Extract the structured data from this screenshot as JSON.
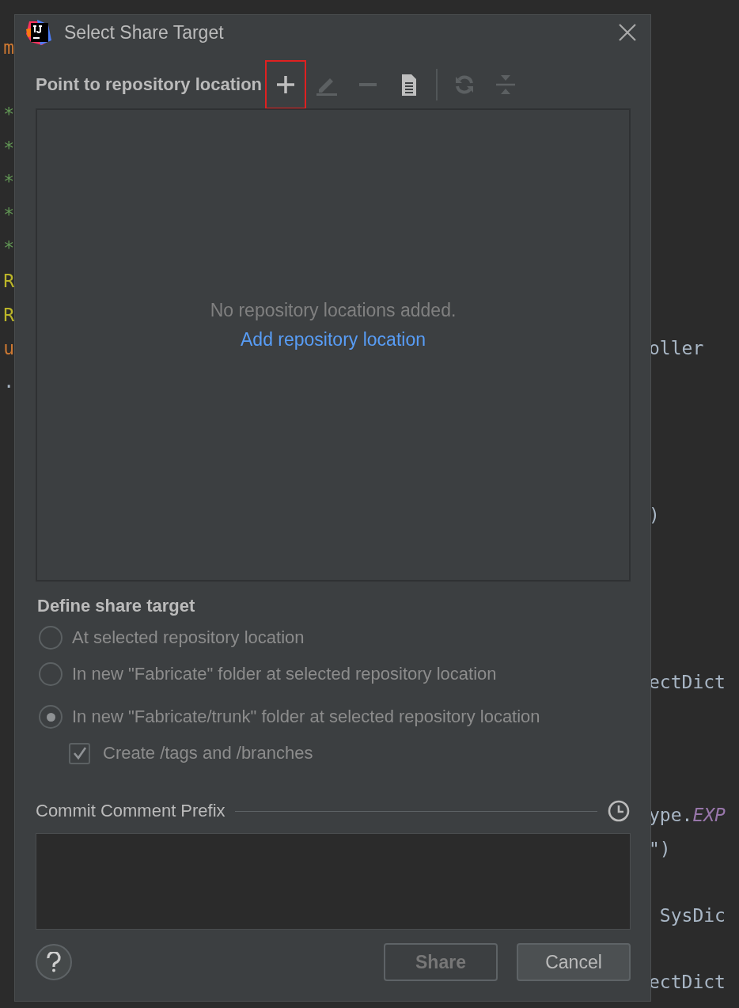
{
  "editor": {
    "left_fragments": [
      {
        "text": "m",
        "kind": "keyword"
      },
      {
        "text": "*",
        "kind": "comment"
      },
      {
        "text": "*",
        "kind": "comment"
      },
      {
        "text": "*",
        "kind": "comment"
      },
      {
        "text": "*",
        "kind": "comment"
      },
      {
        "text": "*",
        "kind": "comment"
      },
      {
        "text": "R",
        "kind": "annotation"
      },
      {
        "text": "R",
        "kind": "annotation"
      },
      {
        "text": "u",
        "kind": "keyword"
      },
      {
        "text": ".",
        "kind": "plain"
      }
    ],
    "right_fragments": [
      {
        "text": "oller",
        "kind": "plain"
      },
      {
        "text": ")",
        "kind": "plain"
      },
      {
        "text": "ectDict",
        "kind": "plain"
      },
      {
        "text": "ype.",
        "kind": "plain"
      },
      {
        "text": "EXP",
        "kind": "constant"
      },
      {
        "text": "\")",
        "kind": "plain"
      },
      {
        "text": " SysDic",
        "kind": "plain"
      },
      {
        "text": "ectDict",
        "kind": "plain"
      }
    ]
  },
  "window": {
    "title": "Select Share Target"
  },
  "locations": {
    "label": "Point to repository location",
    "tools": [
      {
        "kind": "add",
        "disabled": false,
        "highlighted": true
      },
      {
        "kind": "edit",
        "disabled": true,
        "highlighted": false
      },
      {
        "kind": "remove",
        "disabled": true,
        "highlighted": false
      },
      {
        "kind": "document",
        "disabled": false,
        "highlighted": false
      },
      {
        "kind": "separator"
      },
      {
        "kind": "refresh",
        "disabled": true,
        "highlighted": false
      },
      {
        "kind": "collapse",
        "disabled": true,
        "highlighted": false
      }
    ],
    "empty_text": "No repository locations added.",
    "empty_link": "Add repository location"
  },
  "target": {
    "heading": "Define share target",
    "options": [
      {
        "label": "At selected repository location",
        "selected": false,
        "disabled": true
      },
      {
        "label": "In new \"Fabricate\" folder at selected repository location",
        "selected": false,
        "disabled": true
      },
      {
        "label": "In new \"Fabricate/trunk\" folder at selected repository location",
        "selected": true,
        "disabled": true
      }
    ],
    "create_dirs": {
      "label": "Create /tags and /branches",
      "checked": true,
      "disabled": true
    }
  },
  "comment": {
    "label": "Commit Comment Prefix"
  },
  "buttons": [
    {
      "label": "Share",
      "disabled": true
    },
    {
      "label": "Cancel",
      "disabled": false
    }
  ]
}
